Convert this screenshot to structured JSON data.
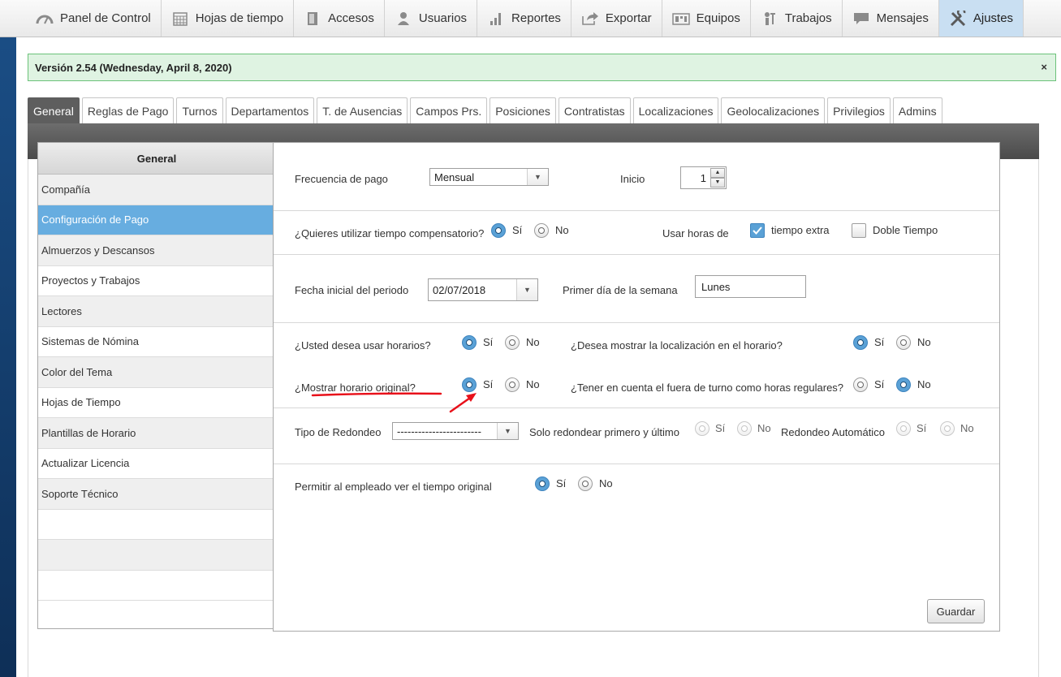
{
  "nav": {
    "items": [
      {
        "label": "Panel de Control",
        "icon": "dashboard-icon"
      },
      {
        "label": "Hojas de tiempo",
        "icon": "calendar-icon"
      },
      {
        "label": "Accesos",
        "icon": "door-icon"
      },
      {
        "label": "Usuarios",
        "icon": "user-icon"
      },
      {
        "label": "Reportes",
        "icon": "bar-chart-icon"
      },
      {
        "label": "Exportar",
        "icon": "export-icon"
      },
      {
        "label": "Equipos",
        "icon": "devices-icon"
      },
      {
        "label": "Trabajos",
        "icon": "workers-icon"
      },
      {
        "label": "Mensajes",
        "icon": "message-icon"
      },
      {
        "label": "Ajustes",
        "icon": "tools-icon"
      }
    ]
  },
  "version": {
    "text": "Versión 2.54 (Wednesday, April 8, 2020)",
    "close": "×"
  },
  "tabs": [
    "General",
    "Reglas de Pago",
    "Turnos",
    "Departamentos",
    "T. de Ausencias",
    "Campos Prs.",
    "Posiciones",
    "Contratistas",
    "Localizaciones",
    "Geolocalizaciones",
    "Privilegios",
    "Admins"
  ],
  "sidemenu": {
    "title": "General",
    "items": [
      "Compañía",
      "Configuración de Pago",
      "Almuerzos y Descansos",
      "Proyectos y Trabajos",
      "Lectores",
      "Sistemas de Nómina",
      "Color del Tema",
      "Hojas de Tiempo",
      "Plantillas de Horario",
      "Actualizar Licencia",
      "Soporte Técnico"
    ]
  },
  "form": {
    "yes": "Sí",
    "no": "No",
    "pay_frequency_label": "Frecuencia de pago",
    "pay_frequency_value": "Mensual",
    "start_label": "Inicio",
    "start_value": "1",
    "comp_time_label": "¿Quieres utilizar tiempo compensatorio?",
    "use_hours_label": "Usar horas de",
    "overtime_label": "tiempo extra",
    "double_time_label": "Doble Tiempo",
    "period_start_label": "Fecha inicial del periodo",
    "period_start_value": "02/07/2018",
    "week_first_day_label": "Primer día de la semana",
    "week_first_day_value": "Lunes",
    "use_schedules_label": "¿Usted desea usar horarios?",
    "show_location_label": "¿Desea mostrar la localización en el horario?",
    "show_original_schedule_label": "¿Mostrar horario original?",
    "off_shift_regular_label": "¿Tener en cuenta el fuera de turno como horas regulares?",
    "rounding_type_label": "Tipo de Redondeo",
    "rounding_type_value": "------------------------",
    "round_first_last_label": "Solo redondear primero y último",
    "auto_rounding_label": "Redondeo Automático",
    "employee_view_original_label": "Permitir al empleado ver el tiempo original",
    "save_label": "Guardar"
  },
  "colors": {
    "accent": "#67ade0",
    "success_border": "#6cc27a",
    "annotation": "#e8101a"
  }
}
